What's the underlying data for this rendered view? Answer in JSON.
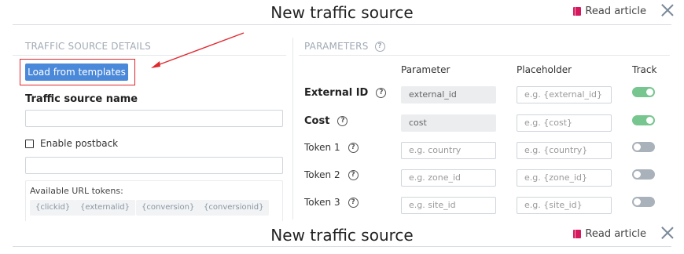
{
  "header": {
    "title": "New traffic source",
    "read_article": "Read article"
  },
  "left": {
    "section_title": "TRAFFIC SOURCE DETAILS",
    "load_templates_label": "Load from templates",
    "traffic_source_name_label": "Traffic source name",
    "traffic_source_name_value": "",
    "enable_postback_label": "Enable postback",
    "postback_value": "",
    "url_tokens_caption": "Available URL tokens:",
    "url_tokens": [
      "{clickid}",
      "{externalid}",
      "{conversion}",
      "{conversionid}"
    ]
  },
  "right": {
    "section_title": "PARAMETERS",
    "col_parameter": "Parameter",
    "col_placeholder": "Placeholder",
    "col_track": "Track",
    "rows": [
      {
        "label": "External ID",
        "parameter_value": "external_id",
        "parameter_placeholder": "",
        "placeholder_placeholder": "e.g. {external_id}",
        "track": true
      },
      {
        "label": "Cost",
        "parameter_value": "cost",
        "parameter_placeholder": "",
        "placeholder_placeholder": "e.g. {cost}",
        "track": true
      },
      {
        "label": "Token 1",
        "parameter_value": "",
        "parameter_placeholder": "e.g. country",
        "placeholder_placeholder": "e.g. {country}",
        "track": false
      },
      {
        "label": "Token 2",
        "parameter_value": "",
        "parameter_placeholder": "e.g. zone_id",
        "placeholder_placeholder": "e.g. {zone_id}",
        "track": false
      },
      {
        "label": "Token 3",
        "parameter_value": "",
        "parameter_placeholder": "e.g. site_id",
        "placeholder_placeholder": "e.g. {site_id}",
        "track": false
      }
    ]
  },
  "colors": {
    "accent_button": "#4a88d9",
    "annotation_red": "#e0282e",
    "toggle_on": "#77c58f",
    "toggle_off": "#a9b1ba",
    "book_icon": "#d6185e"
  },
  "icons": {
    "book": "book-icon",
    "close": "close-icon",
    "help": "help-icon",
    "arrow": "annotation-arrow-icon"
  }
}
